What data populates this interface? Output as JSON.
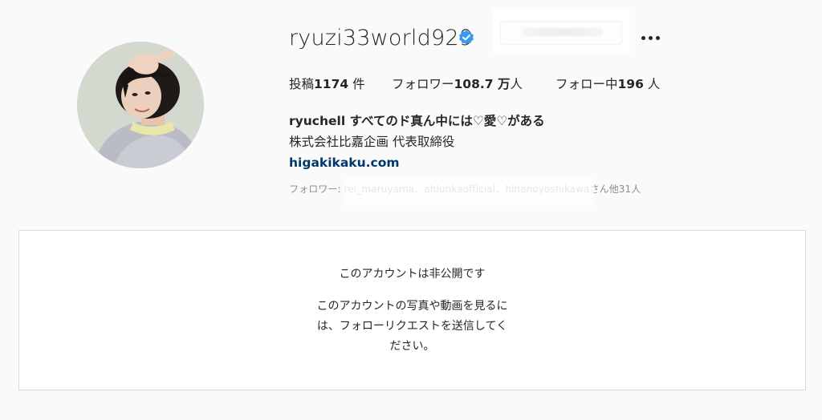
{
  "profile": {
    "username": "ryuzi33world929",
    "verified_badge_icon": "verified-check-icon",
    "verified_color": "#3897f0",
    "more_icon": "more-horizontal-icon"
  },
  "stats": {
    "posts_label": "投稿",
    "posts_value": "1174",
    "posts_unit": " 件",
    "followers_label": "フォロワー",
    "followers_value": "108.7 万",
    "followers_unit": "人",
    "following_label": "フォロー中",
    "following_value": "196",
    "following_unit": " 人"
  },
  "bio": {
    "name_line": "ryuchell すべてのド真ん中には♡愛♡がある",
    "title_line": "株式会社比嘉企画 代表取締役",
    "link": "higakikaku.com"
  },
  "followed_by": {
    "text": "フォロワー: rei_maruyama、ahiunkaofficial、hinanoyoshikawaさん他31人"
  },
  "private_notice": {
    "title": "このアカウントは非公開です",
    "description": "このアカウントの写真や動画を見るには、フォローリクエストを送信してください。"
  }
}
